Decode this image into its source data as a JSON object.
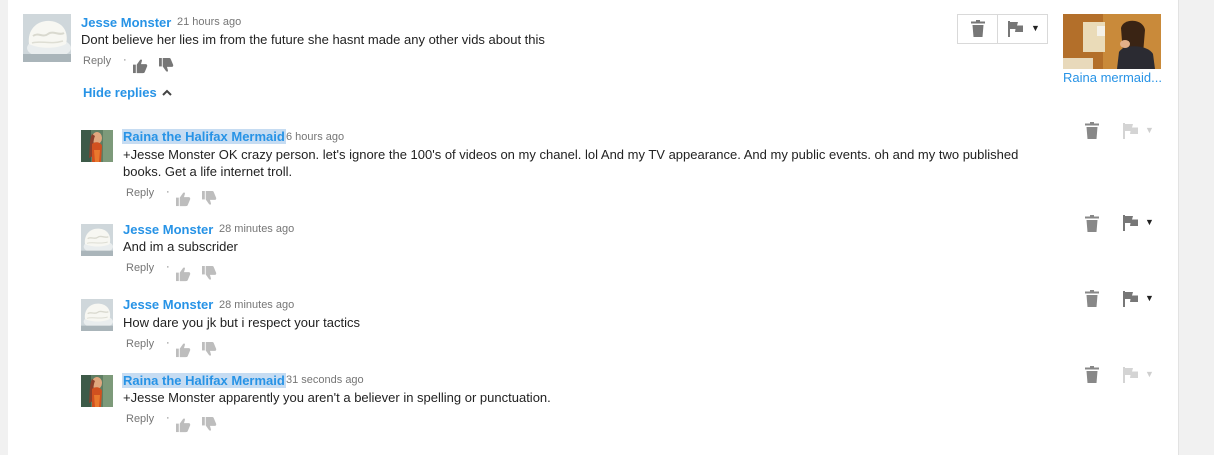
{
  "thread": {
    "hide_replies_label": "Hide replies",
    "video": {
      "title": "Raina mermaid..."
    },
    "top_comment": {
      "author": "Jesse Monster",
      "time": "21 hours ago",
      "text": "Dont believe her lies im from the future she hasnt made any other vids about this",
      "reply_label": "Reply",
      "separator": "·"
    },
    "replies": [
      {
        "author": "Raina the Halifax Mermaid",
        "time": "6 hours ago",
        "text": "+Jesse Monster OK crazy person. let's ignore the 100's of videos on my chanel. lol And my TV appearance. And my public events. oh and my two published books. Get a life internet troll.",
        "reply_label": "Reply",
        "separator": "·"
      },
      {
        "author": "Jesse Monster",
        "time": "28 minutes ago",
        "text": "And im a subscrider",
        "reply_label": "Reply",
        "separator": "·"
      },
      {
        "author": "Jesse Monster",
        "time": "28 minutes ago",
        "text": "How dare you jk but i respect your tactics",
        "reply_label": "Reply",
        "separator": "·"
      },
      {
        "author": "Raina the Halifax Mermaid",
        "time": "31 seconds ago",
        "text": "+Jesse Monster apparently you aren't a believer in spelling or punctuation.",
        "reply_label": "Reply",
        "separator": "·"
      }
    ]
  },
  "icons": {
    "delete": "trash-icon",
    "flag": "flag-icon",
    "like": "thumbs-up-icon",
    "dislike": "thumbs-down-icon",
    "collapse": "chevron-up-icon",
    "dropdown": "caret-down-icon"
  },
  "colors": {
    "link": "#2793e6",
    "owner_highlight": "#c6dcf2",
    "meta_text": "#767676",
    "icon_active": "#777777",
    "icon_faded": "#d4d4d4"
  }
}
